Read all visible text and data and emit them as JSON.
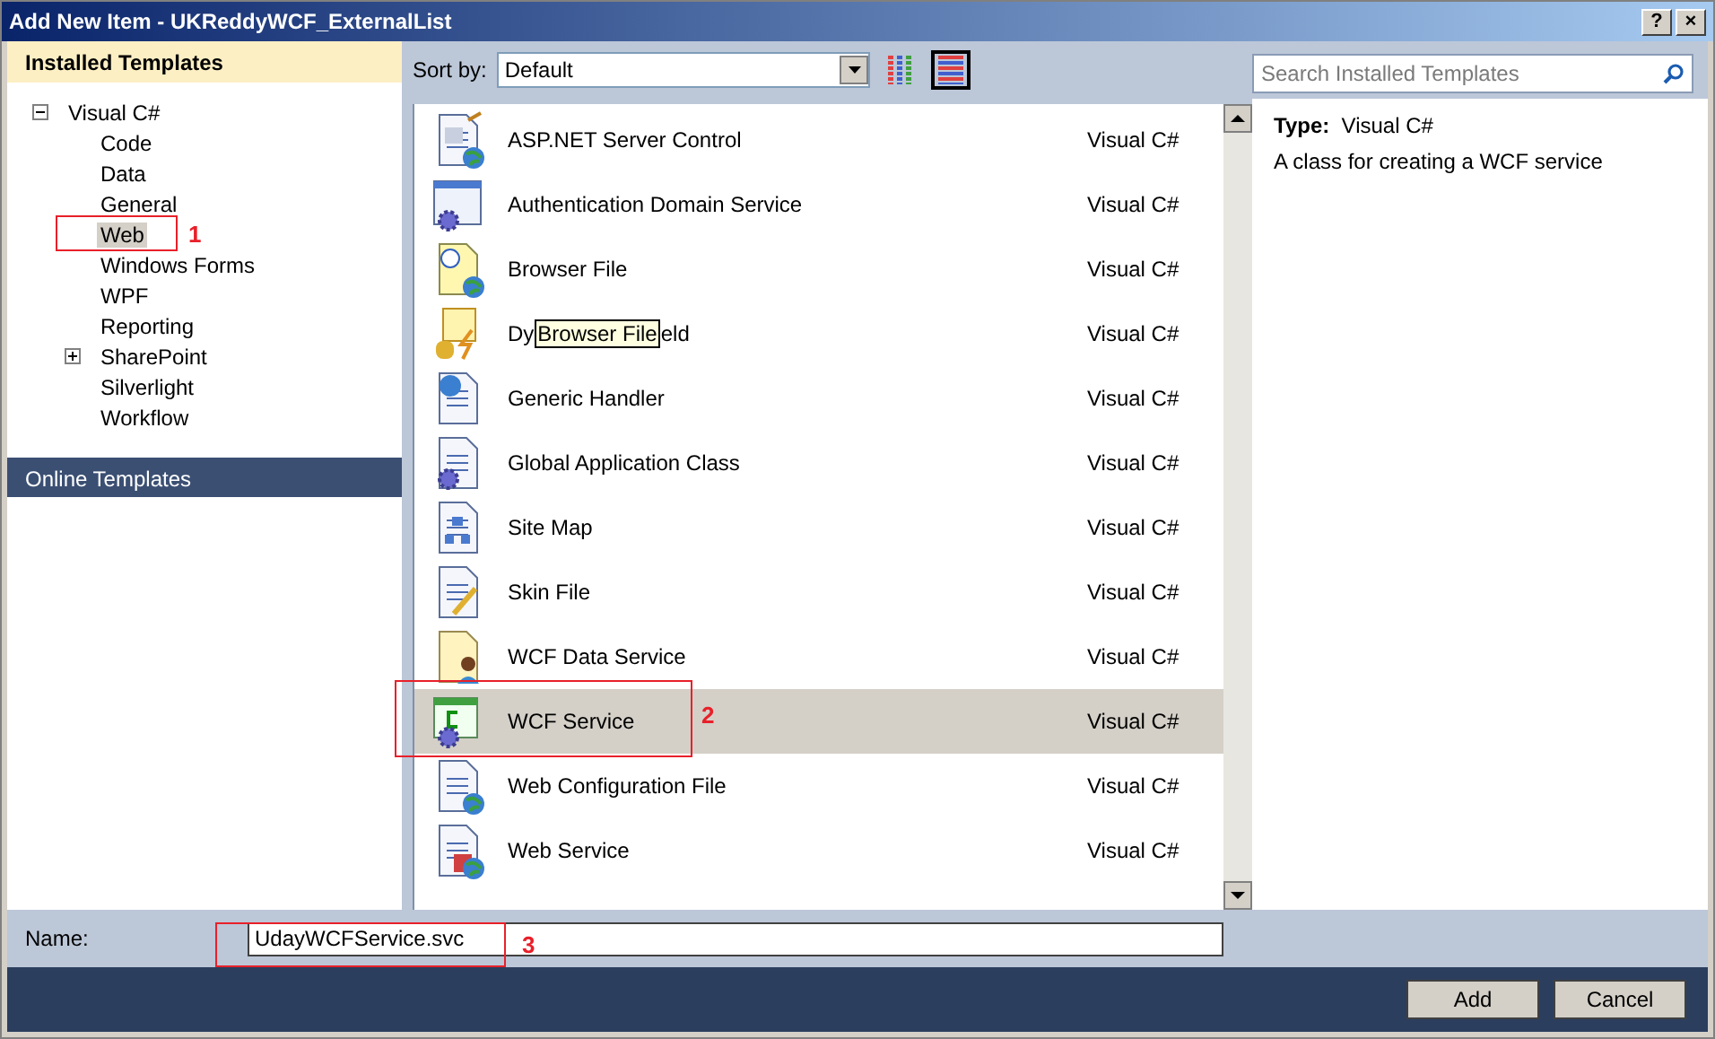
{
  "window": {
    "title": "Add New Item - UKReddyWCF_ExternalList",
    "buttons": [
      "?",
      "×"
    ]
  },
  "sidebar": {
    "header": "Installed Templates",
    "tree": [
      {
        "label": "Visual C#",
        "expanded": true,
        "selected": false,
        "children": [
          {
            "label": "Code",
            "selected": false
          },
          {
            "label": "Data",
            "selected": false
          },
          {
            "label": "General",
            "selected": false
          },
          {
            "label": "Web",
            "selected": true
          },
          {
            "label": "Windows Forms",
            "selected": false
          },
          {
            "label": "WPF",
            "selected": false
          },
          {
            "label": "Reporting",
            "selected": false
          },
          {
            "label": "SharePoint",
            "selected": false,
            "expanded": false
          },
          {
            "label": "Silverlight",
            "selected": false
          },
          {
            "label": "Workflow",
            "selected": false
          }
        ]
      }
    ],
    "online": "Online Templates"
  },
  "toolbar": {
    "sort_label": "Sort by:",
    "sort_value": "Default",
    "view_buttons": [
      {
        "selected": false
      },
      {
        "selected": true
      }
    ]
  },
  "templates": [
    {
      "name": "ASP.NET Server Control",
      "language": "Visual C#",
      "selected": false
    },
    {
      "name": "Authentication Domain Service",
      "language": "Visual C#",
      "selected": false
    },
    {
      "name": "Browser File",
      "language": "Visual C#",
      "selected": false
    },
    {
      "name_start": "Dy",
      "name_end": "eld",
      "tooltip": "Browser File",
      "language": "Visual C#",
      "selected": false
    },
    {
      "name": "Generic Handler",
      "language": "Visual C#",
      "selected": false
    },
    {
      "name": "Global Application Class",
      "language": "Visual C#",
      "selected": false
    },
    {
      "name": "Site Map",
      "language": "Visual C#",
      "selected": false
    },
    {
      "name": "Skin File",
      "language": "Visual C#",
      "selected": false
    },
    {
      "name": "WCF Data Service",
      "language": "Visual C#",
      "selected": false
    },
    {
      "name": "WCF Service",
      "language": "Visual C#",
      "selected": true
    },
    {
      "name": "Web Configuration File",
      "language": "Visual C#",
      "selected": false
    },
    {
      "name": "Web Service",
      "language": "Visual C#",
      "selected": false
    }
  ],
  "details": {
    "search_placeholder": "Search Installed Templates",
    "type_label": "Type:",
    "type_value": "Visual C#",
    "description": "A class for creating a WCF service"
  },
  "name_field": {
    "label": "Name:",
    "value": "UdayWCFService.svc"
  },
  "buttons": [
    "Add",
    "Cancel"
  ],
  "annotations": [
    {
      "label": "1"
    },
    {
      "label": "2"
    },
    {
      "label": "3"
    }
  ]
}
